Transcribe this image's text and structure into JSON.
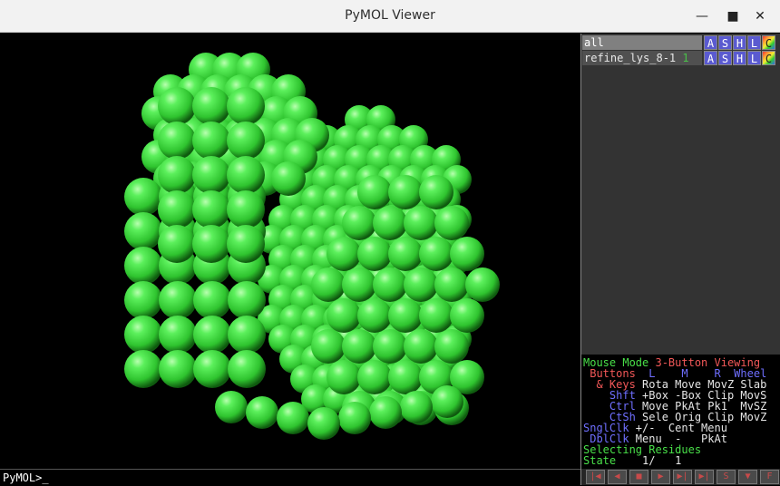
{
  "window": {
    "title": "PyMOL Viewer",
    "minimize_icon": "minimize-icon",
    "maximize_icon": "maximize-icon",
    "close_icon": "close-icon",
    "minimize_glyph": "—",
    "maximize_glyph": "■",
    "close_glyph": "✕"
  },
  "viewport": {
    "background": "#000000",
    "sphere_color": "#3fd23f"
  },
  "command": {
    "prompt": "PyMOL>_"
  },
  "objects": [
    {
      "name": "all",
      "state": "",
      "buttons": [
        "A",
        "S",
        "H",
        "L",
        "C"
      ]
    },
    {
      "name": "refine_lys_8-1",
      "state": "1",
      "buttons": [
        "A",
        "S",
        "H",
        "L",
        "C"
      ]
    }
  ],
  "mouse_legend": {
    "line1": {
      "a": "Mouse Mode ",
      "b": "3-Button Viewing"
    },
    "line2": {
      "a": " Buttons",
      "b": "  L    M    R  Wheel"
    },
    "line3": {
      "a": "  & Keys",
      "b": " Rota Move MovZ Slab"
    },
    "line4": {
      "a": "    Shft",
      "b": " +Box -Box Clip MovS"
    },
    "line5": {
      "a": "    Ctrl",
      "b": " Move PkAt Pk1  MvSZ"
    },
    "line6": {
      "a": "    CtSh",
      "b": " Sele Orig Clip MovZ"
    },
    "line7": {
      "a": "SnglClk",
      "b": " +/-  Cent Menu"
    },
    "line8": {
      "a": " DblClk",
      "b": " Menu  -   PkAt"
    },
    "line9": "Selecting Residues",
    "line10": {
      "a": "State",
      "b": "    1/   1"
    }
  },
  "vcr": {
    "buttons": [
      "|◀",
      "◀",
      "■",
      "▶",
      "▶|",
      "▶|",
      "S",
      "▼",
      "F"
    ]
  }
}
